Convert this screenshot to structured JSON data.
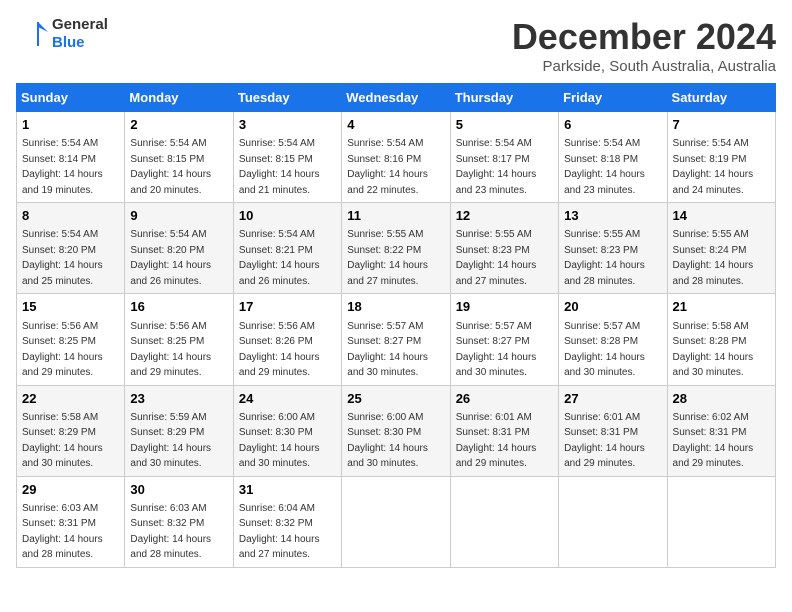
{
  "logo": {
    "line1": "General",
    "line2": "Blue"
  },
  "title": "December 2024",
  "subtitle": "Parkside, South Australia, Australia",
  "headers": [
    "Sunday",
    "Monday",
    "Tuesday",
    "Wednesday",
    "Thursday",
    "Friday",
    "Saturday"
  ],
  "weeks": [
    [
      {
        "day": "1",
        "sunrise": "5:54 AM",
        "sunset": "8:14 PM",
        "daylight": "14 hours and 19 minutes."
      },
      {
        "day": "2",
        "sunrise": "5:54 AM",
        "sunset": "8:15 PM",
        "daylight": "14 hours and 20 minutes."
      },
      {
        "day": "3",
        "sunrise": "5:54 AM",
        "sunset": "8:15 PM",
        "daylight": "14 hours and 21 minutes."
      },
      {
        "day": "4",
        "sunrise": "5:54 AM",
        "sunset": "8:16 PM",
        "daylight": "14 hours and 22 minutes."
      },
      {
        "day": "5",
        "sunrise": "5:54 AM",
        "sunset": "8:17 PM",
        "daylight": "14 hours and 23 minutes."
      },
      {
        "day": "6",
        "sunrise": "5:54 AM",
        "sunset": "8:18 PM",
        "daylight": "14 hours and 23 minutes."
      },
      {
        "day": "7",
        "sunrise": "5:54 AM",
        "sunset": "8:19 PM",
        "daylight": "14 hours and 24 minutes."
      }
    ],
    [
      {
        "day": "8",
        "sunrise": "5:54 AM",
        "sunset": "8:20 PM",
        "daylight": "14 hours and 25 minutes."
      },
      {
        "day": "9",
        "sunrise": "5:54 AM",
        "sunset": "8:20 PM",
        "daylight": "14 hours and 26 minutes."
      },
      {
        "day": "10",
        "sunrise": "5:54 AM",
        "sunset": "8:21 PM",
        "daylight": "14 hours and 26 minutes."
      },
      {
        "day": "11",
        "sunrise": "5:55 AM",
        "sunset": "8:22 PM",
        "daylight": "14 hours and 27 minutes."
      },
      {
        "day": "12",
        "sunrise": "5:55 AM",
        "sunset": "8:23 PM",
        "daylight": "14 hours and 27 minutes."
      },
      {
        "day": "13",
        "sunrise": "5:55 AM",
        "sunset": "8:23 PM",
        "daylight": "14 hours and 28 minutes."
      },
      {
        "day": "14",
        "sunrise": "5:55 AM",
        "sunset": "8:24 PM",
        "daylight": "14 hours and 28 minutes."
      }
    ],
    [
      {
        "day": "15",
        "sunrise": "5:56 AM",
        "sunset": "8:25 PM",
        "daylight": "14 hours and 29 minutes."
      },
      {
        "day": "16",
        "sunrise": "5:56 AM",
        "sunset": "8:25 PM",
        "daylight": "14 hours and 29 minutes."
      },
      {
        "day": "17",
        "sunrise": "5:56 AM",
        "sunset": "8:26 PM",
        "daylight": "14 hours and 29 minutes."
      },
      {
        "day": "18",
        "sunrise": "5:57 AM",
        "sunset": "8:27 PM",
        "daylight": "14 hours and 30 minutes."
      },
      {
        "day": "19",
        "sunrise": "5:57 AM",
        "sunset": "8:27 PM",
        "daylight": "14 hours and 30 minutes."
      },
      {
        "day": "20",
        "sunrise": "5:57 AM",
        "sunset": "8:28 PM",
        "daylight": "14 hours and 30 minutes."
      },
      {
        "day": "21",
        "sunrise": "5:58 AM",
        "sunset": "8:28 PM",
        "daylight": "14 hours and 30 minutes."
      }
    ],
    [
      {
        "day": "22",
        "sunrise": "5:58 AM",
        "sunset": "8:29 PM",
        "daylight": "14 hours and 30 minutes."
      },
      {
        "day": "23",
        "sunrise": "5:59 AM",
        "sunset": "8:29 PM",
        "daylight": "14 hours and 30 minutes."
      },
      {
        "day": "24",
        "sunrise": "6:00 AM",
        "sunset": "8:30 PM",
        "daylight": "14 hours and 30 minutes."
      },
      {
        "day": "25",
        "sunrise": "6:00 AM",
        "sunset": "8:30 PM",
        "daylight": "14 hours and 30 minutes."
      },
      {
        "day": "26",
        "sunrise": "6:01 AM",
        "sunset": "8:31 PM",
        "daylight": "14 hours and 29 minutes."
      },
      {
        "day": "27",
        "sunrise": "6:01 AM",
        "sunset": "8:31 PM",
        "daylight": "14 hours and 29 minutes."
      },
      {
        "day": "28",
        "sunrise": "6:02 AM",
        "sunset": "8:31 PM",
        "daylight": "14 hours and 29 minutes."
      }
    ],
    [
      {
        "day": "29",
        "sunrise": "6:03 AM",
        "sunset": "8:31 PM",
        "daylight": "14 hours and 28 minutes."
      },
      {
        "day": "30",
        "sunrise": "6:03 AM",
        "sunset": "8:32 PM",
        "daylight": "14 hours and 28 minutes."
      },
      {
        "day": "31",
        "sunrise": "6:04 AM",
        "sunset": "8:32 PM",
        "daylight": "14 hours and 27 minutes."
      },
      null,
      null,
      null,
      null
    ]
  ]
}
